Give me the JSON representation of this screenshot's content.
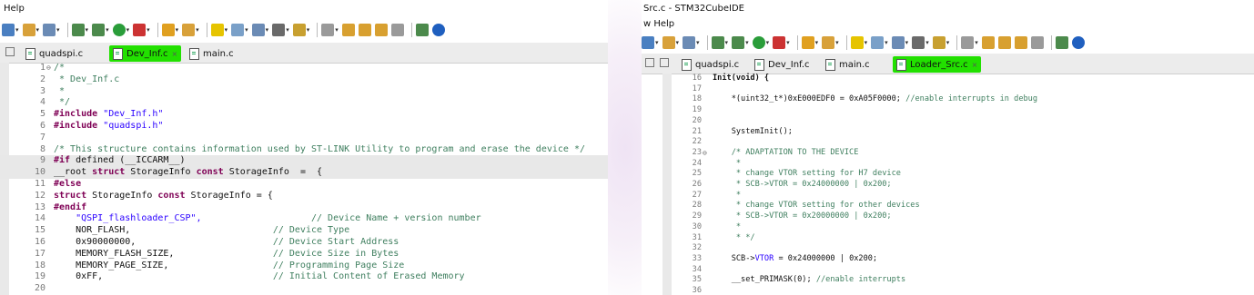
{
  "left": {
    "menu_label": "Help",
    "tabs": [
      {
        "label": "quadspi.c",
        "active": false
      },
      {
        "label": "Dev_Inf.c",
        "active": true
      },
      {
        "label": "main.c",
        "active": false
      }
    ],
    "close_glyph": "⨯",
    "lines": [
      {
        "n": "1",
        "fold": "⊖",
        "parts": [
          [
            "cm",
            "/*"
          ]
        ]
      },
      {
        "n": "2",
        "parts": [
          [
            "cm",
            " * Dev_Inf.c"
          ]
        ]
      },
      {
        "n": "3",
        "parts": [
          [
            "cm",
            " *"
          ]
        ]
      },
      {
        "n": "4",
        "parts": [
          [
            "cm",
            " */"
          ]
        ]
      },
      {
        "n": "5",
        "parts": [
          [
            "hash",
            "#include"
          ],
          [
            "str",
            " \"Dev_Inf.h\""
          ]
        ]
      },
      {
        "n": "6",
        "parts": [
          [
            "hash",
            "#include"
          ],
          [
            "str",
            " \"quadspi.h\""
          ]
        ]
      },
      {
        "n": "7",
        "parts": [
          [
            "",
            ""
          ]
        ]
      },
      {
        "n": "8",
        "parts": [
          [
            "cm",
            "/* This structure contains information used by ST-LINK Utility to program and erase the device */"
          ]
        ]
      },
      {
        "n": "9",
        "hl": true,
        "parts": [
          [
            "hash",
            "#if"
          ],
          [
            "mac",
            " defined (__ICCARM__)"
          ]
        ]
      },
      {
        "n": "10",
        "hl": true,
        "parts": [
          [
            "mac",
            "__root "
          ],
          [
            "kw",
            "struct"
          ],
          [
            "mac",
            " StorageInfo "
          ],
          [
            "kw",
            "const"
          ],
          [
            "mac",
            " StorageInfo  =  {"
          ]
        ]
      },
      {
        "n": "11",
        "parts": [
          [
            "hash",
            "#else"
          ]
        ]
      },
      {
        "n": "12",
        "parts": [
          [
            "kw",
            "struct"
          ],
          [
            "mac",
            " StorageInfo "
          ],
          [
            "kw",
            "const"
          ],
          [
            "mac",
            " StorageInfo = {"
          ]
        ]
      },
      {
        "n": "13",
        "parts": [
          [
            "hash",
            "#endif"
          ]
        ]
      },
      {
        "n": "14",
        "parts": [
          [
            "str",
            "    \"QSPI_flashloader_CSP\","
          ],
          [
            "mac",
            "                    "
          ],
          [
            "cm",
            "// Device Name + version number"
          ]
        ]
      },
      {
        "n": "15",
        "parts": [
          [
            "mac",
            "    NOR_FLASH,                          "
          ],
          [
            "cm",
            "// Device Type"
          ]
        ]
      },
      {
        "n": "16",
        "parts": [
          [
            "mac",
            "    0x90000000,                         "
          ],
          [
            "cm",
            "// Device Start Address"
          ]
        ]
      },
      {
        "n": "17",
        "parts": [
          [
            "mac",
            "    MEMORY_FLASH_SIZE,                  "
          ],
          [
            "cm",
            "// Device Size in Bytes"
          ]
        ]
      },
      {
        "n": "18",
        "parts": [
          [
            "mac",
            "    MEMORY_PAGE_SIZE,                   "
          ],
          [
            "cm",
            "// Programming Page Size"
          ]
        ]
      },
      {
        "n": "19",
        "parts": [
          [
            "mac",
            "    0xFF,                               "
          ],
          [
            "cm",
            "// Initial Content of Erased Memory"
          ]
        ]
      },
      {
        "n": "20",
        "parts": [
          [
            "",
            ""
          ]
        ]
      }
    ]
  },
  "right": {
    "window_title": "Src.c - STM32CubeIDE",
    "menu_label": "w  Help",
    "tabs": [
      {
        "label": "quadspi.c",
        "active": false
      },
      {
        "label": "Dev_Inf.c",
        "active": false
      },
      {
        "label": "main.c",
        "active": false
      },
      {
        "label": "Loader_Src.c",
        "active": true
      }
    ],
    "close_glyph": "⨯",
    "lines": [
      {
        "n": "16",
        "parts": [
          [
            "kw2",
            "Init(void) {"
          ]
        ]
      },
      {
        "n": "17",
        "parts": [
          [
            "",
            ""
          ]
        ]
      },
      {
        "n": "18",
        "parts": [
          [
            "mac",
            "    *(uint32_t*)0xE000EDF0 = 0xA05F0000; "
          ],
          [
            "cm",
            "//enable interrupts in debug"
          ]
        ]
      },
      {
        "n": "19",
        "parts": [
          [
            "",
            ""
          ]
        ]
      },
      {
        "n": "20",
        "parts": [
          [
            "",
            ""
          ]
        ]
      },
      {
        "n": "21",
        "parts": [
          [
            "mac",
            "    SystemInit();"
          ]
        ]
      },
      {
        "n": "22",
        "parts": [
          [
            "",
            ""
          ]
        ]
      },
      {
        "n": "23",
        "fold": "⊖",
        "parts": [
          [
            "cm",
            "    /* ADAPTATION TO THE DEVICE"
          ]
        ]
      },
      {
        "n": "24",
        "parts": [
          [
            "cm",
            "     *"
          ]
        ]
      },
      {
        "n": "25",
        "parts": [
          [
            "cm",
            "     * change VTOR setting for H7 device"
          ]
        ]
      },
      {
        "n": "26",
        "parts": [
          [
            "cm",
            "     * SCB->VTOR = 0x24000000 | 0x200;"
          ]
        ]
      },
      {
        "n": "27",
        "parts": [
          [
            "cm",
            "     *"
          ]
        ]
      },
      {
        "n": "28",
        "parts": [
          [
            "cm",
            "     * change VTOR setting for other devices"
          ]
        ]
      },
      {
        "n": "29",
        "parts": [
          [
            "cm",
            "     * SCB->VTOR = 0x20000000 | 0x200;"
          ]
        ]
      },
      {
        "n": "30",
        "parts": [
          [
            "cm",
            "     *"
          ]
        ]
      },
      {
        "n": "31",
        "parts": [
          [
            "cm",
            "     * */"
          ]
        ]
      },
      {
        "n": "32",
        "parts": [
          [
            "",
            ""
          ]
        ]
      },
      {
        "n": "33",
        "parts": [
          [
            "mac",
            "    SCB->"
          ],
          [
            "str",
            "VTOR"
          ],
          [
            "mac",
            " = 0x24000000 | 0x200;"
          ]
        ]
      },
      {
        "n": "34",
        "parts": [
          [
            "",
            ""
          ]
        ]
      },
      {
        "n": "35",
        "parts": [
          [
            "mac",
            "    __set_PRIMASK(0); "
          ],
          [
            "cm",
            "//enable interrupts"
          ]
        ]
      },
      {
        "n": "36",
        "parts": [
          [
            "",
            ""
          ]
        ]
      }
    ]
  },
  "toolbar_icons": [
    "new-icon",
    "save-icon",
    "print-icon",
    "settings-icon",
    "debug-icon",
    "run-icon",
    "external-tools-icon",
    "open-folder-icon",
    "wand-icon",
    "highlight-icon",
    "format-icon",
    "toggle-icon",
    "pilcrow-icon",
    "annotation-icon",
    "nav-icon",
    "back-icon",
    "forward-icon",
    "left-arrow-icon",
    "right-arrow-icon",
    "perspective-icon",
    "info-icon"
  ],
  "colors": {
    "active_tab_highlight": "#22e000",
    "comment": "#3f7f5f",
    "keyword": "#7f0055",
    "string": "#2a00ff",
    "gutter": "#e9e9e9"
  }
}
